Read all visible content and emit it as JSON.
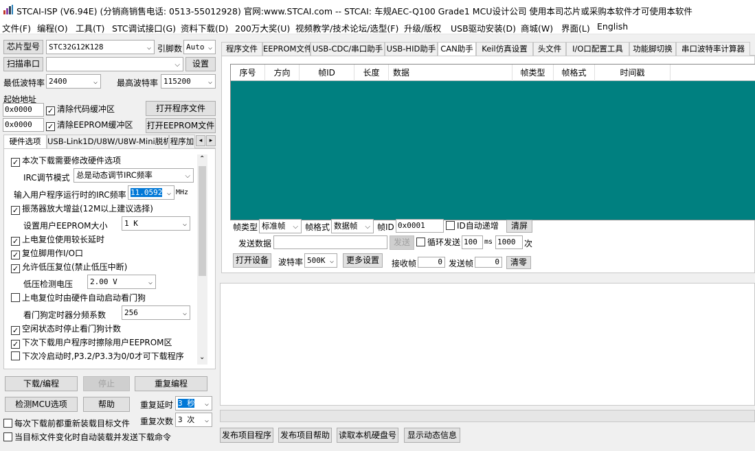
{
  "window": {
    "title": "STCAI-ISP (V6.94E) (分销商销售电话: 0513-55012928) 官网:www.STCAI.com  -- STCAI: 车规AEC-Q100 Grade1 MCU设计公司 使用本司芯片或采购本软件才可使用本软件"
  },
  "menu": [
    "文件(F)",
    "编程(O)",
    "工具(T)",
    "STC调试接口(G)",
    "资料下载(D)",
    "200万大奖(U)",
    "视频教学/技术论坛/选型(F)",
    "升级/版权",
    "USB驱动安装(D)",
    "商城(W)",
    "界面(L)",
    "English"
  ],
  "left": {
    "chip_label": "芯片型号",
    "chip_value": "STC32G12K128",
    "pins_label": "引脚数",
    "pins_value": "Auto",
    "scan_btn": "扫描串口",
    "port_value": "",
    "settings_btn": "设置",
    "min_baud_label": "最低波特率",
    "min_baud_value": "2400",
    "max_baud_label": "最高波特率",
    "max_baud_value": "115200",
    "start_addr_label": "起始地址",
    "addr1": "0x0000",
    "clear_code_label": "清除代码缓冲区",
    "open_prog_btn": "打开程序文件",
    "addr2": "0x0000",
    "clear_eeprom_label": "清除EEPROM缓冲区",
    "open_eeprom_btn": "打开EEPROM文件",
    "tabs": [
      "硬件选项",
      "USB-Link1D/U8W/U8W-Mini脱机",
      "程序加"
    ],
    "opt_download_hw": "本次下载需要修改硬件选项",
    "irc_mode_label": "IRC调节模式",
    "irc_mode_value": "总是动态调节IRC频率",
    "irc_freq_label": "输入用户程序运行时的IRC频率",
    "irc_freq_value": "11.0592",
    "irc_freq_unit": "MHz",
    "osc_gain": "振荡器放大增益(12M以上建议选择)",
    "eeprom_size_label": "设置用户EEPROM大小",
    "eeprom_size_value": "1   K",
    "por_delay": "上电复位使用较长延时",
    "reset_pin_io": "复位脚用作I/O口",
    "lvr": "允许低压复位(禁止低压中断)",
    "lvd_label": "低压检测电压",
    "lvd_value": "2.00 V",
    "wdt_hw": "上电复位时由硬件自动启动看门狗",
    "wdt_div_label": "看门狗定时器分频系数",
    "wdt_div_value": "256",
    "wdt_idle": "空闲状态时停止看门狗计数",
    "erase_eeprom": "下次下载用户程序时擦除用户EEPROM区",
    "cold_boot": "下次冷启动时,P3.2/P3.3为0/0才可下载程序",
    "download_btn": "下载/编程",
    "stop_btn": "停止",
    "reprogram_btn": "重复编程",
    "detect_btn": "检测MCU选项",
    "help_btn": "帮助",
    "repeat_delay_label": "重复延时",
    "repeat_delay_value": "3 秒",
    "repeat_count_label": "重复次数",
    "repeat_count_value": "3 次",
    "reload_before": "每次下载前都重新装载目标文件",
    "auto_reload": "当目标文件变化时自动装载并发送下载命令"
  },
  "right": {
    "tabs": [
      "程序文件",
      "EEPROM文件",
      "USB-CDC/串口助手",
      "USB-HID助手",
      "CAN助手",
      "Keil仿真设置",
      "头文件",
      "I/O口配置工具",
      "功能脚切换",
      "串口波特率计算器"
    ],
    "columns": [
      "序号",
      "方向",
      "帧ID",
      "长度",
      "数据",
      "帧类型",
      "帧格式",
      "时间戳"
    ],
    "frame_type_label": "帧类型",
    "frame_type_value": "标准帧",
    "frame_format_label": "帧格式",
    "frame_format_value": "数据帧",
    "frame_id_label": "帧ID",
    "frame_id_value": "0x0001",
    "id_auto_inc": "ID自动递增",
    "clear_btn": "清屏",
    "send_data_label": "发送数据",
    "send_data_value": "",
    "send_btn": "发送",
    "loop_send": "循环发送",
    "loop_ms_value": "100",
    "ms_unit": "ms",
    "loop_count_value": "1000",
    "count_unit": "次",
    "open_device_btn": "打开设备",
    "baud_label": "波特率",
    "baud_value": "500K",
    "more_settings_btn": "更多设置",
    "recv_label": "接收帧",
    "recv_value": "0",
    "sent_label": "发送帧",
    "sent_value": "0",
    "reset_btn": "清零",
    "publish_prog_btn": "发布项目程序",
    "publish_help_btn": "发布项目帮助",
    "read_disk_btn": "读取本机硬盘号",
    "show_dyn_btn": "显示动态信息"
  }
}
